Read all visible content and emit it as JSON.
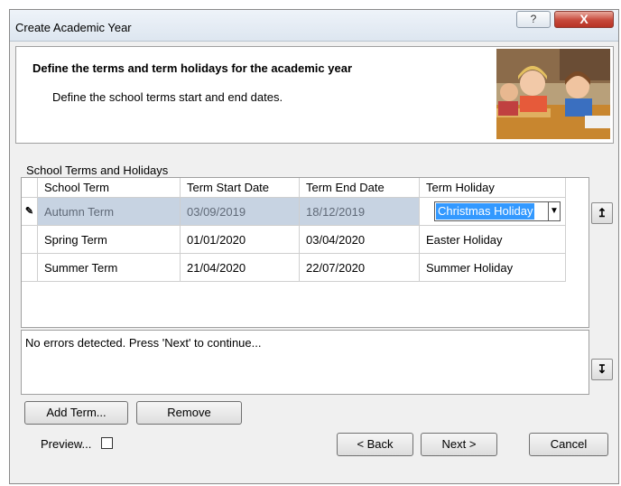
{
  "window": {
    "title": "Create Academic Year",
    "help_label": "?",
    "close_label": "X"
  },
  "header": {
    "title": "Define the terms and term holidays for the academic year",
    "subtitle": "Define the school terms start and end dates."
  },
  "terms_section": {
    "label": "School Terms and Holidays",
    "columns": [
      "School Term",
      "Term Start Date",
      "Term End Date",
      "Term Holiday"
    ],
    "rows": [
      {
        "term": "Autumn Term",
        "start": "03/09/2019",
        "end": "18/12/2019",
        "holiday": "Christmas Holiday",
        "selected": true
      },
      {
        "term": "Spring Term",
        "start": "01/01/2020",
        "end": "03/04/2020",
        "holiday": "Easter Holiday"
      },
      {
        "term": "Summer Term",
        "start": "21/04/2020",
        "end": "22/07/2020",
        "holiday": "Summer Holiday"
      }
    ],
    "edit_marker": "✎"
  },
  "messages": {
    "status": "No errors detected. Press 'Next' to continue..."
  },
  "buttons": {
    "add_term": "Add Term...",
    "remove": "Remove",
    "preview": "Preview...",
    "back": "< Back",
    "next": "Next >",
    "cancel": "Cancel",
    "move_up": "↥",
    "move_down": "↧"
  },
  "icons": {
    "header_image": "classroom-children-photo",
    "dropdown": "dropdown-arrow-icon"
  }
}
